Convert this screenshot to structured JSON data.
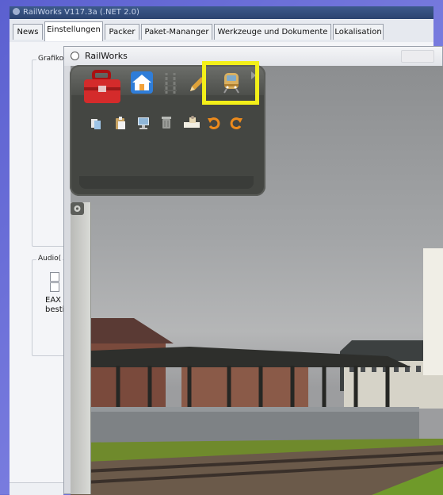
{
  "back_window": {
    "title": "RailWorks V117.3a (.NET 2.0)",
    "tabs": [
      "News",
      "Einstellungen",
      "Packer",
      "Paket-Mananger",
      "Werkzeuge und Dokumente",
      "Lokalisation"
    ],
    "active_tab": "Einstellungen",
    "group_grafik_label": "Grafiko",
    "group_audio_label": "Audio(",
    "eax_text_line1": "EAX",
    "eax_text_line2": "besti"
  },
  "railworks_window": {
    "title": "RailWorks",
    "toolbar": {
      "top_icons": [
        "toolbox-icon",
        "home-icon",
        "track-icon",
        "pencil-icon",
        "train-icon"
      ],
      "bottom_icons": [
        "copy-icon",
        "paste-icon",
        "monitor-icon",
        "trash-icon",
        "stamp-icon",
        "undo-icon",
        "redo-icon"
      ]
    },
    "highlighted_tool": "train-icon"
  },
  "colors": {
    "frame": "#6a6fd6",
    "highlight": "#f3ef19",
    "toolbar_bg": "#444642",
    "toolbox_red": "#d42b2b"
  }
}
